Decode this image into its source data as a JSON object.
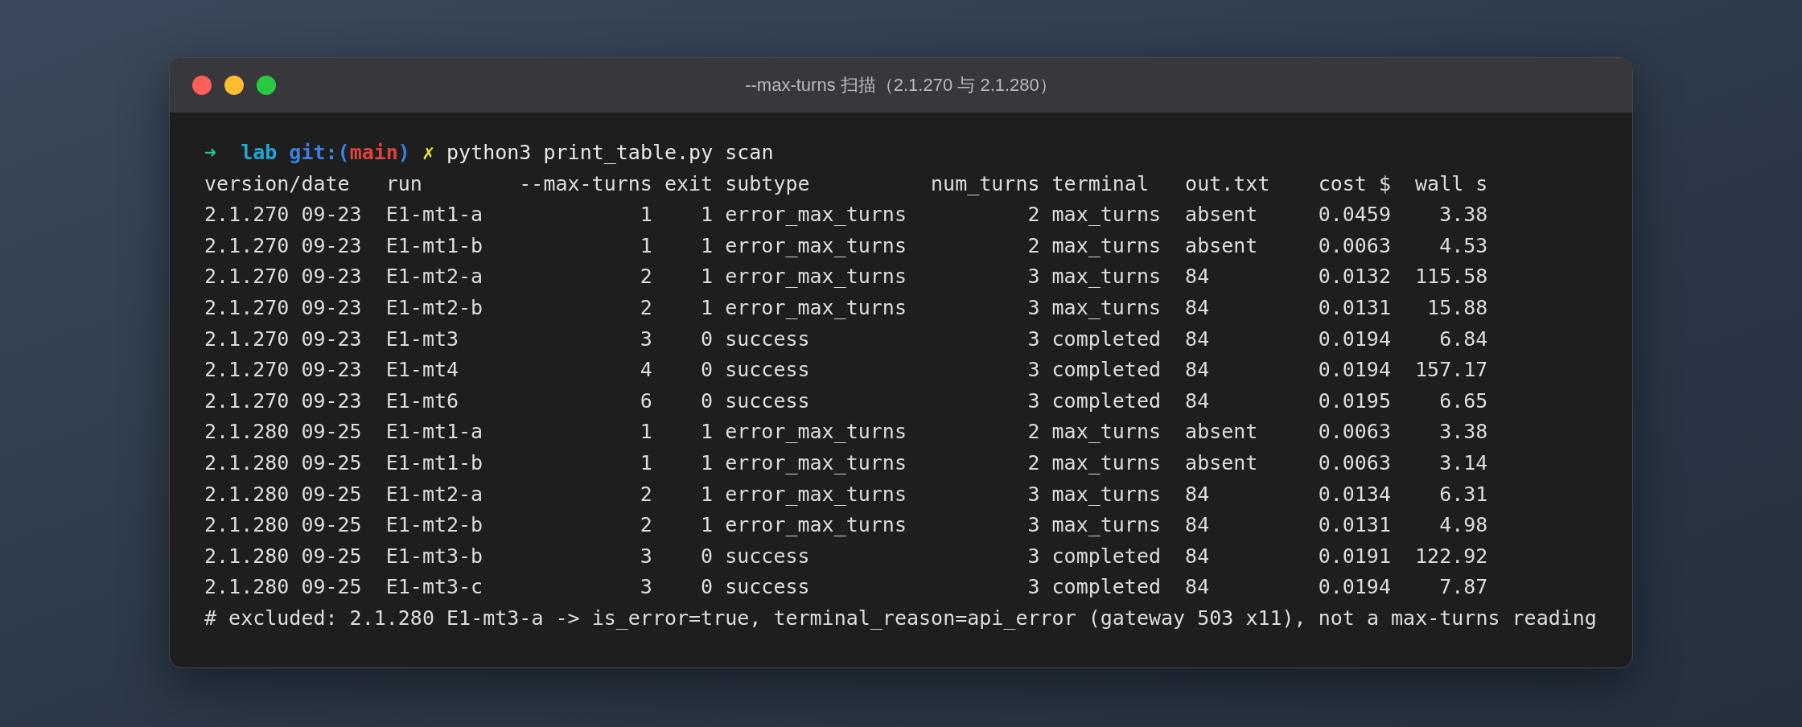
{
  "window": {
    "title": "--max-turns 扫描（2.1.270 与 2.1.280）"
  },
  "prompt": [
    {
      "kind": "arrow",
      "text": "➜"
    },
    {
      "kind": "directory",
      "text": "lab"
    },
    {
      "kind": "git",
      "text": "git:("
    },
    {
      "kind": "branch",
      "text": "main"
    },
    {
      "kind": "git",
      "text": ")"
    },
    {
      "kind": "dirty",
      "text": "✗"
    },
    {
      "kind": "command",
      "text": "python3 print_table.py scan"
    }
  ],
  "table": {
    "columns": [
      "version/date",
      "run",
      "--max-turns",
      "exit",
      "subtype",
      "num_turns",
      "terminal",
      "out.txt",
      "cost $",
      "wall s"
    ],
    "rows": [
      [
        "2.1.270 09-23",
        "E1-mt1-a",
        "1",
        "1",
        "error_max_turns",
        "2",
        "max_turns",
        "absent",
        "0.0459",
        "3.38"
      ],
      [
        "2.1.270 09-23",
        "E1-mt1-b",
        "1",
        "1",
        "error_max_turns",
        "2",
        "max_turns",
        "absent",
        "0.0063",
        "4.53"
      ],
      [
        "2.1.270 09-23",
        "E1-mt2-a",
        "2",
        "1",
        "error_max_turns",
        "3",
        "max_turns",
        "84",
        "0.0132",
        "115.58"
      ],
      [
        "2.1.270 09-23",
        "E1-mt2-b",
        "2",
        "1",
        "error_max_turns",
        "3",
        "max_turns",
        "84",
        "0.0131",
        "15.88"
      ],
      [
        "2.1.270 09-23",
        "E1-mt3",
        "3",
        "0",
        "success",
        "3",
        "completed",
        "84",
        "0.0194",
        "6.84"
      ],
      [
        "2.1.270 09-23",
        "E1-mt4",
        "4",
        "0",
        "success",
        "3",
        "completed",
        "84",
        "0.0194",
        "157.17"
      ],
      [
        "2.1.270 09-23",
        "E1-mt6",
        "6",
        "0",
        "success",
        "3",
        "completed",
        "84",
        "0.0195",
        "6.65"
      ],
      [
        "2.1.280 09-25",
        "E1-mt1-a",
        "1",
        "1",
        "error_max_turns",
        "2",
        "max_turns",
        "absent",
        "0.0063",
        "3.38"
      ],
      [
        "2.1.280 09-25",
        "E1-mt1-b",
        "1",
        "1",
        "error_max_turns",
        "2",
        "max_turns",
        "absent",
        "0.0063",
        "3.14"
      ],
      [
        "2.1.280 09-25",
        "E1-mt2-a",
        "2",
        "1",
        "error_max_turns",
        "3",
        "max_turns",
        "84",
        "0.0134",
        "6.31"
      ],
      [
        "2.1.280 09-25",
        "E1-mt2-b",
        "2",
        "1",
        "error_max_turns",
        "3",
        "max_turns",
        "84",
        "0.0131",
        "4.98"
      ],
      [
        "2.1.280 09-25",
        "E1-mt3-b",
        "3",
        "0",
        "success",
        "3",
        "completed",
        "84",
        "0.0191",
        "122.92"
      ],
      [
        "2.1.280 09-25",
        "E1-mt3-c",
        "3",
        "0",
        "success",
        "3",
        "completed",
        "84",
        "0.0194",
        "7.87"
      ]
    ]
  },
  "footer": "# excluded: 2.1.280 E1-mt3-a -> is_error=true, terminal_reason=api_error (gateway 503 x11), not a max-turns reading"
}
